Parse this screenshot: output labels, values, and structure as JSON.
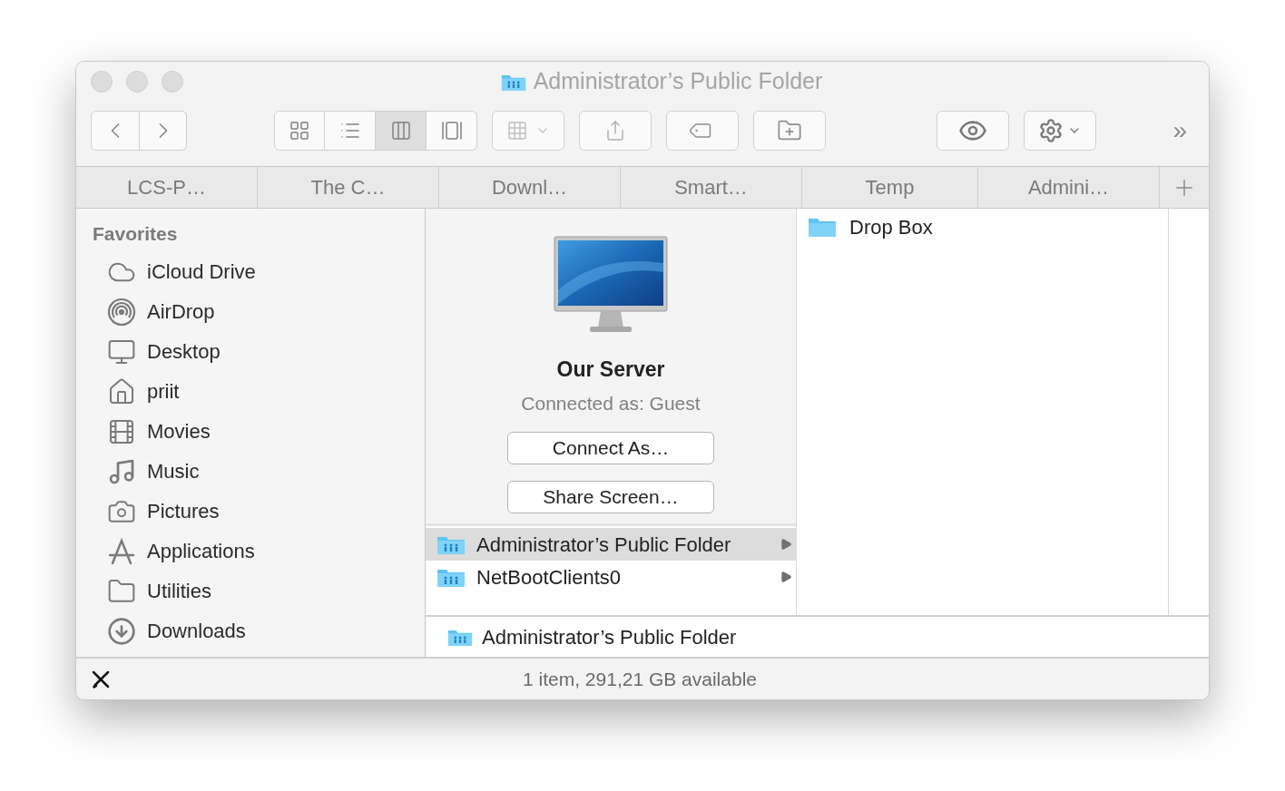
{
  "window": {
    "title": "Administrator’s Public Folder"
  },
  "toolbar": {
    "view_modes": [
      {
        "kind": "icons",
        "selected": false
      },
      {
        "kind": "list",
        "selected": false
      },
      {
        "kind": "columns",
        "selected": true
      },
      {
        "kind": "coverflow",
        "selected": false
      }
    ],
    "overflow": "»"
  },
  "tabs": [
    {
      "label": "LCS-P…"
    },
    {
      "label": "The C…"
    },
    {
      "label": "Downl…"
    },
    {
      "label": "Smart…"
    },
    {
      "label": "Temp"
    },
    {
      "label": "Admini…"
    }
  ],
  "sidebar": {
    "heading": "Favorites",
    "items": [
      {
        "label": "iCloud Drive",
        "kind": "cloud"
      },
      {
        "label": "AirDrop",
        "kind": "airdrop"
      },
      {
        "label": "Desktop",
        "kind": "desktop"
      },
      {
        "label": "priit",
        "kind": "home"
      },
      {
        "label": "Movies",
        "kind": "movies"
      },
      {
        "label": "Music",
        "kind": "music"
      },
      {
        "label": "Pictures",
        "kind": "pictures"
      },
      {
        "label": "Applications",
        "kind": "applications"
      },
      {
        "label": "Utilities",
        "kind": "folder"
      },
      {
        "label": "Downloads",
        "kind": "downloads"
      }
    ]
  },
  "server": {
    "name": "Our Server",
    "status": "Connected as: Guest",
    "buttons": [
      "Connect As…",
      "Share Screen…"
    ]
  },
  "shares": [
    {
      "label": "Administrator’s Public Folder",
      "selected": true
    },
    {
      "label": "NetBootClients0",
      "selected": false
    }
  ],
  "column_2": [
    {
      "label": "Drop Box"
    }
  ],
  "path_bar": {
    "label": "Administrator’s Public Folder"
  },
  "status_bar": {
    "text": "1 item, 291,21 GB available"
  }
}
